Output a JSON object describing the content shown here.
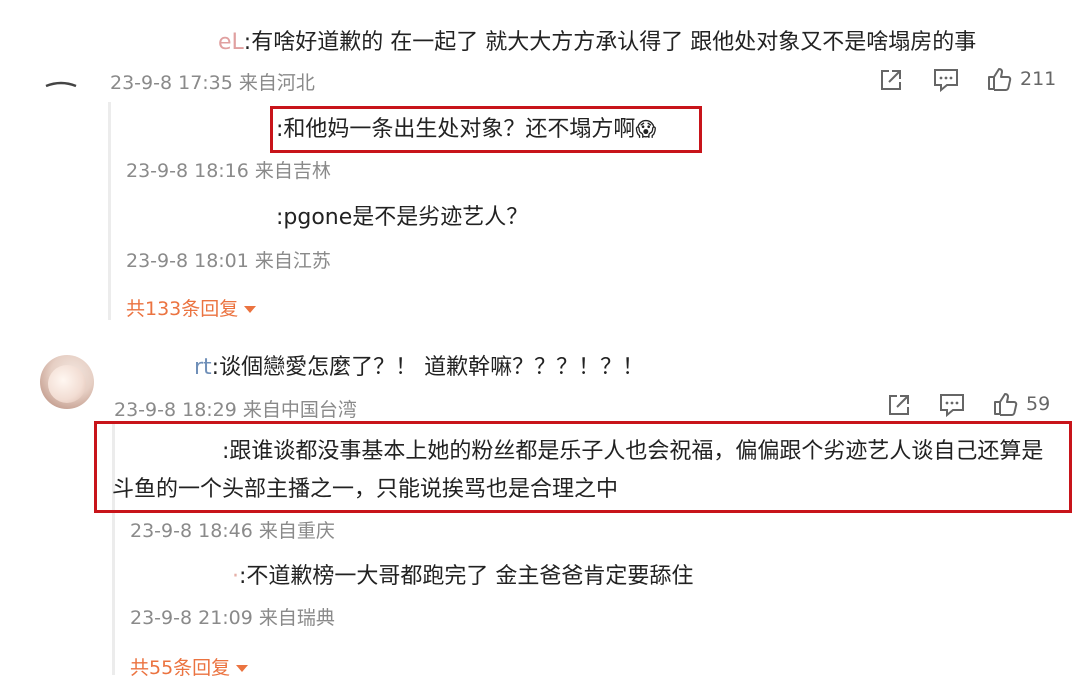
{
  "comment1": {
    "user_fragment": "eL",
    "text": ":有啥好道歉的 在一起了 就大大方方承认得了  跟他处对象又不是啥塌房的事",
    "meta": "23-9-8 17:35 来自河北",
    "like_count": "211",
    "replies": [
      {
        "text": ":和他妈一条出生处对象？还不塌方啊",
        "emoji": "😱",
        "meta": "23-9-8 18:16 来自吉林"
      },
      {
        "text": ":pgone是不是劣迹艺人？",
        "meta": "23-9-8 18:01 来自江苏"
      }
    ],
    "more_replies": "共133条回复"
  },
  "comment2": {
    "user_fragment": "rt",
    "text": ":谈個戀愛怎麼了？！ 道歉幹嘛？？？！？！",
    "meta": "23-9-8 18:29 来自中国台湾",
    "like_count": "59",
    "replies": [
      {
        "text_line1": ":跟谁谈都没事基本上她的粉丝都是乐子人也会祝福，偏偏跟个劣迹艺人谈自己还算是",
        "text_line2": "斗鱼的一个头部主播之一，只能说挨骂也是合理之中",
        "meta": "23-9-8 18:46 来自重庆"
      },
      {
        "text": ":不道歉榜一大哥都跑完了 金主爸爸肯定要舔住",
        "meta": "23-9-8 21:09 来自瑞典"
      }
    ],
    "more_replies": "共55条回复"
  },
  "icons": {
    "share": "share-icon",
    "comment": "comment-icon",
    "like": "thumbs-up-icon",
    "caret": "caret-down-icon"
  },
  "colors": {
    "highlight_border": "#c8141a",
    "more_replies": "#eb7340",
    "meta": "#8a8a8a"
  }
}
